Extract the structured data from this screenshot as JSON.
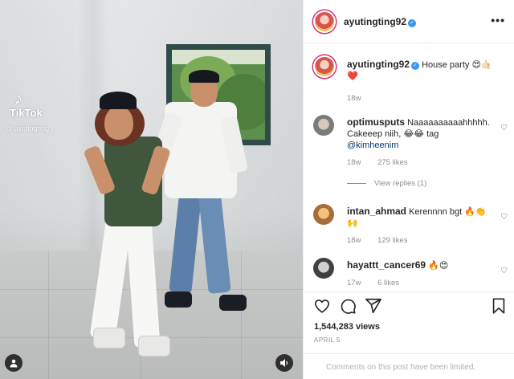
{
  "video": {
    "watermark": {
      "brand": "TikTok",
      "handle": "@ ayutingting"
    }
  },
  "post": {
    "author": "ayutingting92",
    "more_label": "•••",
    "caption": {
      "username": "ayutingting92",
      "text": "House party 😍🤙🏻",
      "text_line2": "❤️",
      "time": "18w"
    },
    "comments": [
      {
        "username": "optimusputs",
        "text_line1": "Naaaaaaaaaahhhhh.",
        "text_line2": "Cakeeep niih, 😂😂 tag",
        "mention": "@kimheenim",
        "time": "18w",
        "likes": "275 likes",
        "replies": "View replies (1)"
      },
      {
        "username": "intan_ahmad",
        "text_line1": "Kerennnn bgt 🔥👏",
        "text_line2": "🙌",
        "time": "18w",
        "likes": "129 likes"
      },
      {
        "username": "hayattt_cancer69",
        "text_line1": "🔥😍",
        "time": "17w",
        "likes": "6 likes"
      }
    ],
    "views": "1,544,283 views",
    "date": "APRIL 5",
    "comments_limited": "Comments on this post have been limited."
  },
  "icons": {
    "like": "heart-icon",
    "comment": "comment-icon",
    "share": "share-icon",
    "save": "bookmark-icon",
    "volume": "volume-icon",
    "tags": "user-tag-icon"
  }
}
